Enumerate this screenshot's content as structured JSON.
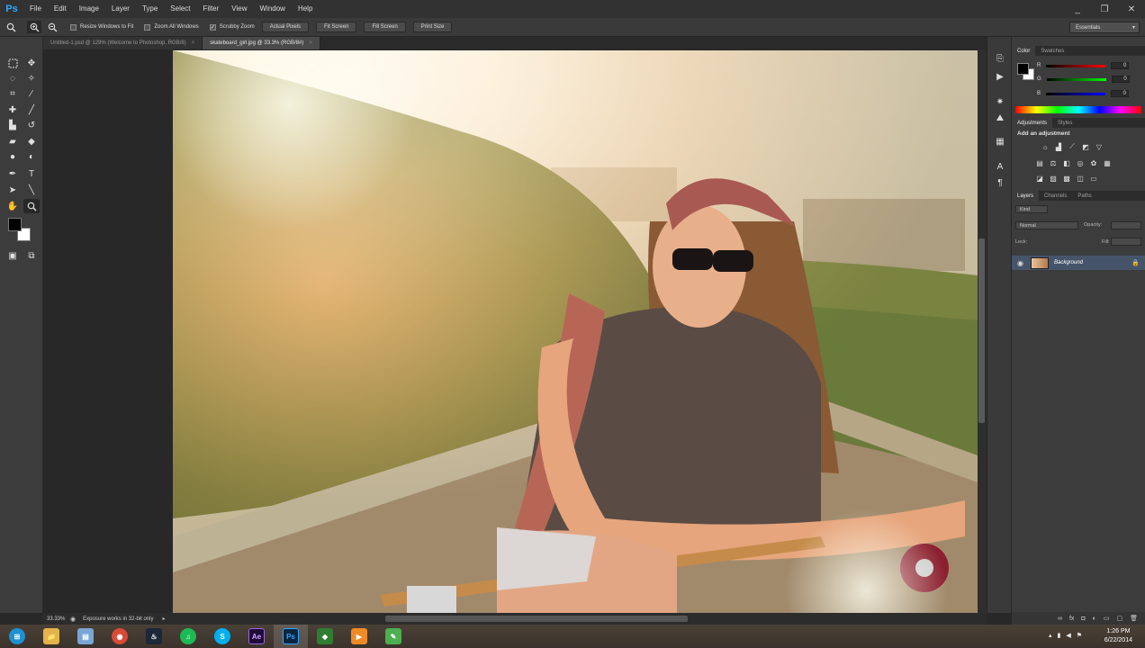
{
  "app": {
    "logo": "Ps"
  },
  "menu": [
    "File",
    "Edit",
    "Image",
    "Layer",
    "Type",
    "Select",
    "Filter",
    "View",
    "Window",
    "Help"
  ],
  "window_controls": {
    "minimize": "_",
    "restore": "❐",
    "close": "✕"
  },
  "options": {
    "resize_windows": "Resize Windows to Fit",
    "zoom_all": "Zoom All Windows",
    "scrubby_zoom": "Scrubby Zoom",
    "actual_pixels": "Actual Pixels",
    "fit_screen": "Fit Screen",
    "fill_screen": "Fill Screen",
    "print_size": "Print Size",
    "workspace": "Essentials"
  },
  "tabs": [
    {
      "label": "Untitled-1.psd @ 129% (Welcome to Photoshop, RGB/8)",
      "close": "×"
    },
    {
      "label": "skateboard_girl.jpg @ 33.3% (RGB/8#)",
      "close": "×"
    }
  ],
  "status": {
    "zoom": "33.33%",
    "info": "Exposure works in 32-bit only"
  },
  "color_panel": {
    "tabs": [
      "Color",
      "Swatches"
    ],
    "channels": [
      {
        "label": "R",
        "value": "0",
        "color": "#e02020"
      },
      {
        "label": "G",
        "value": "0",
        "color": "#20c020"
      },
      {
        "label": "B",
        "value": "0",
        "color": "#2040e0"
      }
    ]
  },
  "adjustments_panel": {
    "tabs": [
      "Adjustments",
      "Styles"
    ],
    "title": "Add an adjustment"
  },
  "layers_panel": {
    "tabs": [
      "Layers",
      "Channels",
      "Paths"
    ],
    "kind": "Kind",
    "blend_mode": "Normal",
    "opacity_label": "Opacity:",
    "lock_label": "Lock:",
    "fill_label": "Fill:",
    "layer_name": "Background"
  },
  "clock": {
    "time": "1:26 PM",
    "date": "6/22/2014"
  },
  "taskbar_apps": [
    {
      "name": "windows-start",
      "label": "⊞",
      "color": "#1e90d0"
    },
    {
      "name": "file-explorer",
      "label": "📁",
      "color": "#e3b44a"
    },
    {
      "name": "notepad",
      "label": "▤",
      "color": "#7aa6d6"
    },
    {
      "name": "chrome",
      "label": "◉",
      "color": "#d94a38"
    },
    {
      "name": "steam",
      "label": "♨",
      "color": "#1b2838"
    },
    {
      "name": "spotify",
      "label": "♫",
      "color": "#1db954"
    },
    {
      "name": "skype",
      "label": "S",
      "color": "#00aff0"
    },
    {
      "name": "after-effects",
      "label": "Ae",
      "color": "#1f0a3a"
    },
    {
      "name": "photoshop",
      "label": "Ps",
      "color": "#0a2540"
    },
    {
      "name": "app-green",
      "label": "◆",
      "color": "#2e7d32"
    },
    {
      "name": "media-player",
      "label": "▶",
      "color": "#f08a24"
    },
    {
      "name": "app-misc",
      "label": "✎",
      "color": "#4caf50"
    }
  ]
}
